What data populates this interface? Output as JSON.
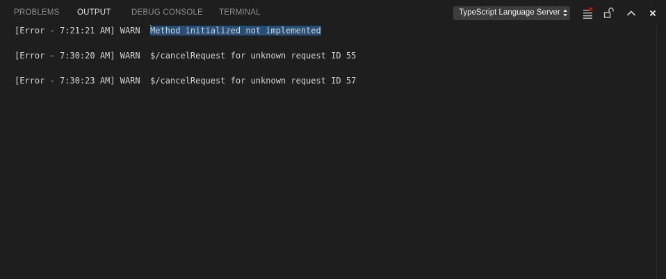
{
  "tabs": [
    {
      "label": "PROBLEMS",
      "active": false
    },
    {
      "label": "OUTPUT",
      "active": true
    },
    {
      "label": "DEBUG CONSOLE",
      "active": false
    },
    {
      "label": "TERMINAL",
      "active": false
    }
  ],
  "channel_select": {
    "value": "TypeScript Language Server"
  },
  "actions": {
    "clear": "clear-output-icon",
    "lock": "lock-scroll-icon",
    "maximize": "chevron-up-icon",
    "close": "close-icon"
  },
  "output_lines": [
    {
      "prefix": "[Error - 7:21:21 AM] WARN  ",
      "message": "Method initialized not implemented",
      "selected": true
    },
    {
      "prefix": "[Error - 7:30:20 AM] WARN  ",
      "message": "$/cancelRequest for unknown request ID 55",
      "selected": false
    },
    {
      "prefix": "[Error - 7:30:23 AM] WARN  ",
      "message": "$/cancelRequest for unknown request ID 57",
      "selected": false
    }
  ],
  "colors": {
    "background": "#1e1e1e",
    "selection": "#264f78",
    "active_tab": "#e7e7e7",
    "inactive_tab": "#8f8f8f",
    "select_bg": "#3c3c3c"
  }
}
